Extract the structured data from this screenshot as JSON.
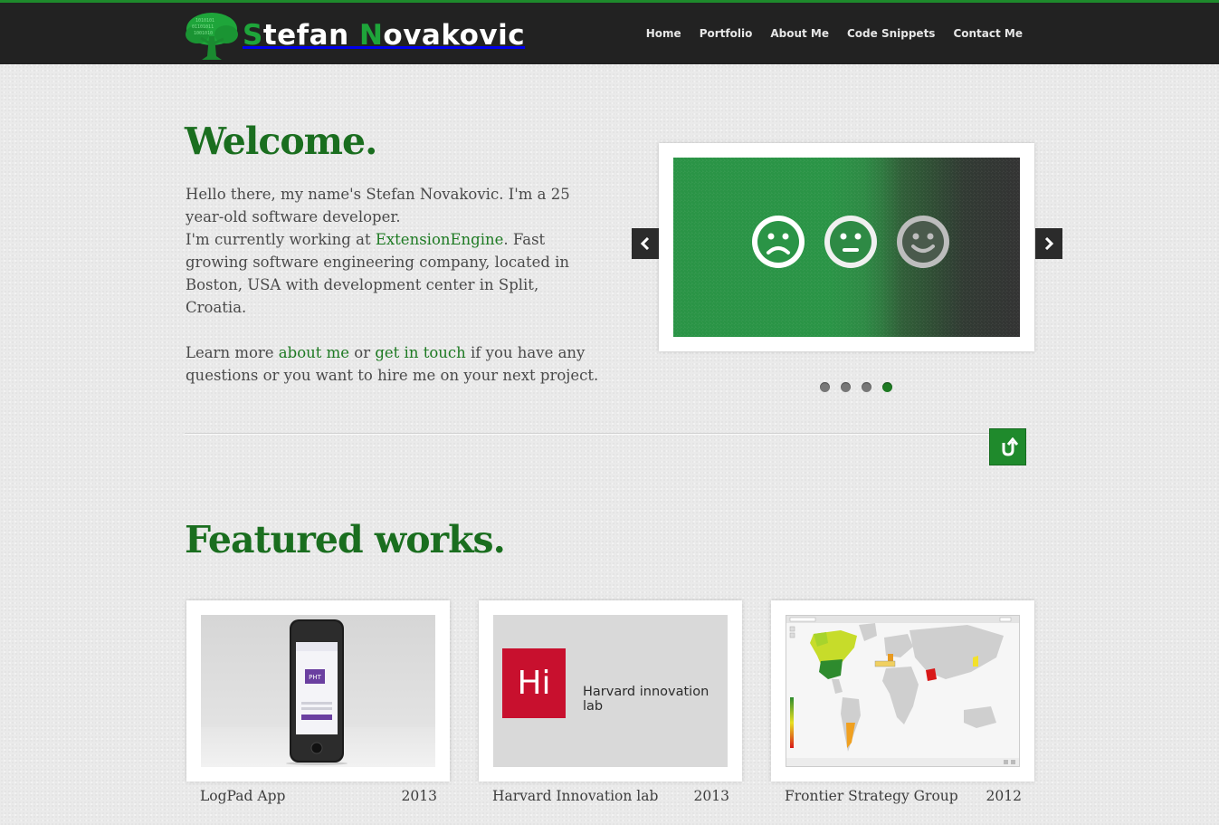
{
  "site": {
    "logo_initial_1": "S",
    "logo_rest_1": "tefan",
    "logo_initial_2": "N",
    "logo_rest_2": "ovakovic"
  },
  "nav": {
    "home": "Home",
    "portfolio": "Portfolio",
    "about": "About Me",
    "snippets": "Code Snippets",
    "contact": "Contact Me"
  },
  "welcome": {
    "title": "Welcome.",
    "p1_a": "Hello there, my name's Stefan Novakovic. I'm a 25 year-old software developer.",
    "p1_b": "I'm currently working at ",
    "p1_link": "ExtensionEngine",
    "p1_c": ". Fast growing software engineering company, located in Boston, USA with development center in Split, Croatia.",
    "p2_a": "Learn more ",
    "p2_link1": "about me",
    "p2_b": " or ",
    "p2_link2": "get in touch",
    "p2_c": " if you have any questions or you want to hire me on your next project."
  },
  "slider": {
    "active_index": 3,
    "slide_count": 4,
    "faces": [
      "sad-face-icon",
      "neutral-face-icon",
      "happy-face-icon"
    ]
  },
  "featured": {
    "title": "Featured works.",
    "works": [
      {
        "name": "LogPad App",
        "year": "2013",
        "thumb_text": "PHT"
      },
      {
        "name": "Harvard Innovation lab",
        "year": "2013",
        "thumb_text": "Hi",
        "thumb_label": "Harvard innovation lab"
      },
      {
        "name": "Frontier Strategy Group",
        "year": "2012"
      }
    ]
  },
  "colors": {
    "brand_green": "#1e8a2c",
    "heading_green": "#1a6e1f",
    "header_bg": "#222222"
  }
}
